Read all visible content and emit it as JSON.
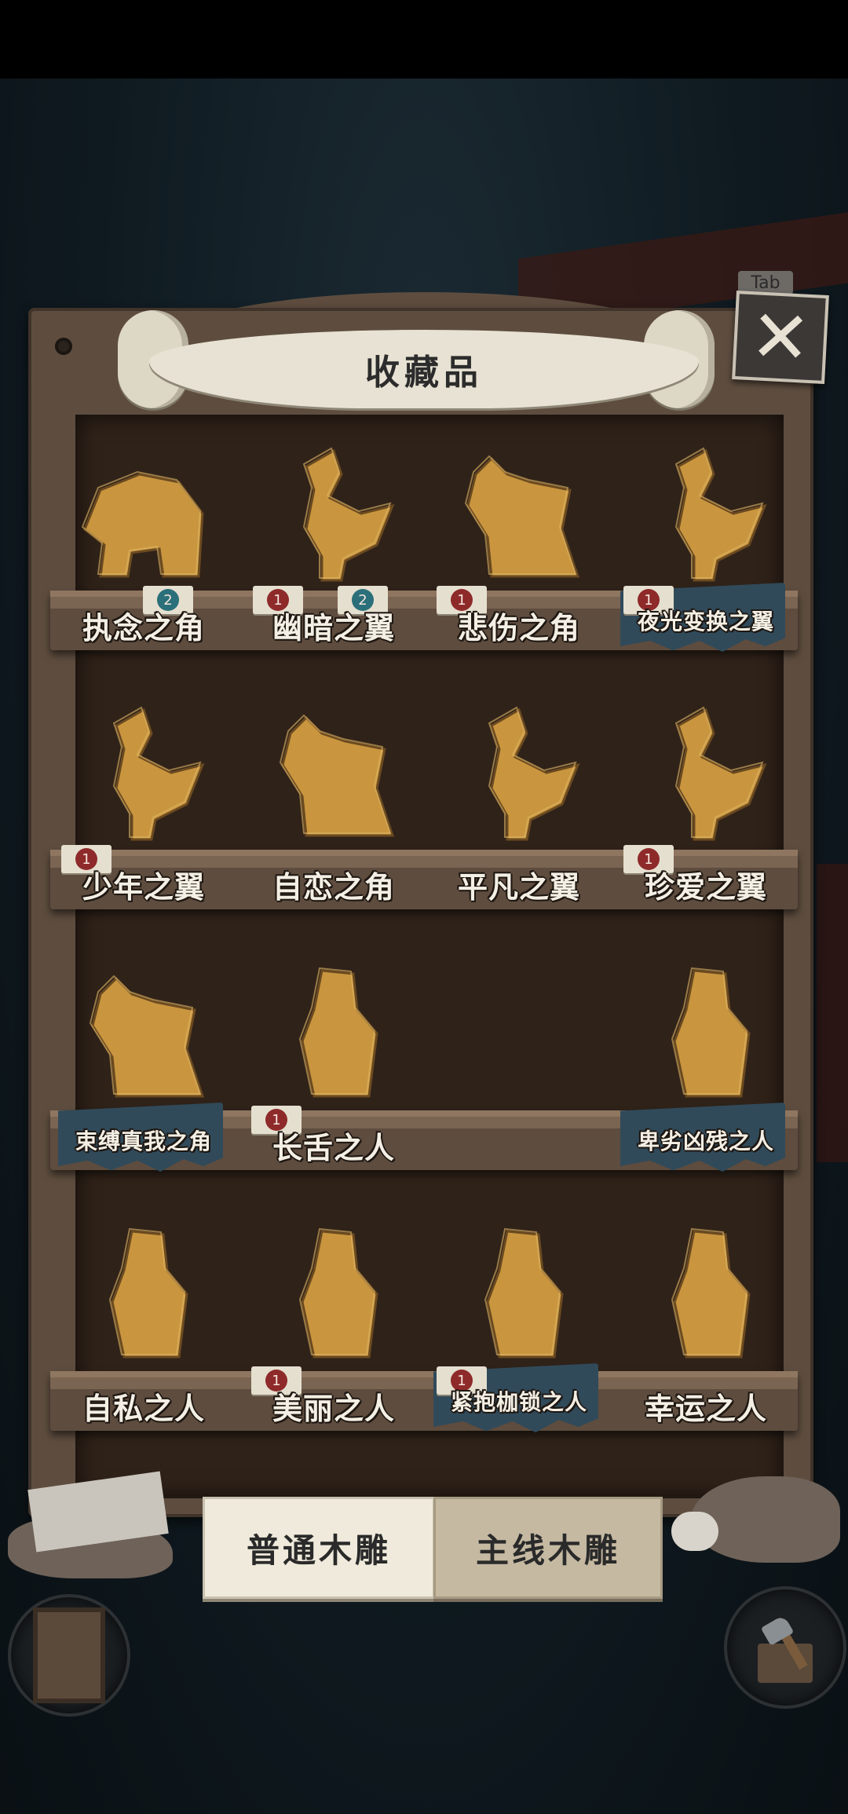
{
  "header": {
    "title": "收藏品",
    "close_label": "✕",
    "tab_hint": "Tab"
  },
  "colors": {
    "wood": "#5e4d3f",
    "cabinet_inner": "#2f2219",
    "figurine": "#c9963f",
    "badge_red": "#8e2a2a",
    "badge_teal": "#2b6f7a",
    "base_blue": "#304a5a"
  },
  "shelves": [
    {
      "items": [
        {
          "name": "执念之角",
          "shape": "elephant",
          "has_base": false,
          "badges": [
            {
              "value": "2",
              "color": "teal"
            }
          ]
        },
        {
          "name": "幽暗之翼",
          "shape": "bird",
          "has_base": false,
          "badges": [
            {
              "value": "1",
              "color": "red"
            },
            {
              "value": "2",
              "color": "teal"
            }
          ]
        },
        {
          "name": "悲伤之角",
          "shape": "beast",
          "has_base": false,
          "badges": [
            {
              "value": "1",
              "color": "red"
            }
          ]
        },
        {
          "name": "夜光变换之翼",
          "shape": "bird",
          "has_base": true,
          "badges": [
            {
              "value": "1",
              "color": "red"
            }
          ]
        }
      ]
    },
    {
      "items": [
        {
          "name": "少年之翼",
          "shape": "bird",
          "has_base": false,
          "badges": [
            {
              "value": "1",
              "color": "red"
            }
          ]
        },
        {
          "name": "自恋之角",
          "shape": "beast",
          "has_base": false,
          "badges": []
        },
        {
          "name": "平凡之翼",
          "shape": "bird",
          "has_base": false,
          "badges": []
        },
        {
          "name": "珍爱之翼",
          "shape": "bird",
          "has_base": false,
          "badges": [
            {
              "value": "1",
              "color": "red"
            }
          ]
        }
      ]
    },
    {
      "items": [
        {
          "name": "束缚真我之角",
          "shape": "beast",
          "has_base": true,
          "badges": []
        },
        {
          "name": "长舌之人",
          "shape": "person",
          "has_base": false,
          "badges": [
            {
              "value": "1",
              "color": "red"
            }
          ]
        },
        {
          "name": "",
          "shape": "none",
          "has_base": false,
          "badges": []
        },
        {
          "name": "卑劣凶残之人",
          "shape": "person",
          "has_base": true,
          "badges": []
        }
      ]
    },
    {
      "items": [
        {
          "name": "自私之人",
          "shape": "person",
          "has_base": false,
          "badges": []
        },
        {
          "name": "美丽之人",
          "shape": "person",
          "has_base": false,
          "badges": [
            {
              "value": "1",
              "color": "red"
            }
          ]
        },
        {
          "name": "紧抱枷锁之人",
          "shape": "person",
          "has_base": true,
          "badges": [
            {
              "value": "1",
              "color": "red"
            }
          ]
        },
        {
          "name": "幸运之人",
          "shape": "person",
          "has_base": false,
          "badges": []
        }
      ]
    }
  ],
  "tabs": [
    {
      "label": "普通木雕",
      "active": true
    },
    {
      "label": "主线木雕",
      "active": false
    }
  ],
  "bottom_icons": {
    "left": "door-icon",
    "right": "axe-stump-icon"
  }
}
